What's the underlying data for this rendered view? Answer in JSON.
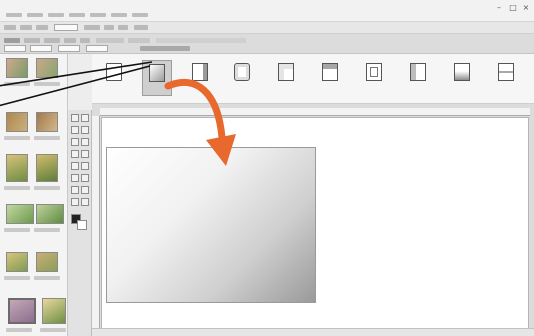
{
  "window": {
    "title": "",
    "minimize_icon": "minimize-icon",
    "maximize_icon": "maximize-icon",
    "close_icon": "close-icon"
  },
  "gallery": {
    "items": [
      {
        "label": "",
        "icon": "square-shape-icon",
        "selected": false
      },
      {
        "label": "",
        "icon": "gradient-square-icon",
        "selected": true
      },
      {
        "label": "",
        "icon": "square-right-shade-icon",
        "selected": false
      },
      {
        "label": "",
        "icon": "square-inner-icon",
        "selected": false
      },
      {
        "label": "",
        "icon": "square-corner-icon",
        "selected": false
      },
      {
        "label": "",
        "icon": "square-top-shade-icon",
        "selected": false
      },
      {
        "label": "",
        "icon": "square-frame-icon",
        "selected": false
      },
      {
        "label": "",
        "icon": "square-side-icon",
        "selected": false
      },
      {
        "label": "",
        "icon": "square-bottom-shade-icon",
        "selected": false
      },
      {
        "label": "",
        "icon": "square-split-icon",
        "selected": false
      }
    ]
  },
  "colors": {
    "callout_arrow": "#e8692e",
    "callout_line": "#111111",
    "selection_bg": "#cfcfcf"
  }
}
